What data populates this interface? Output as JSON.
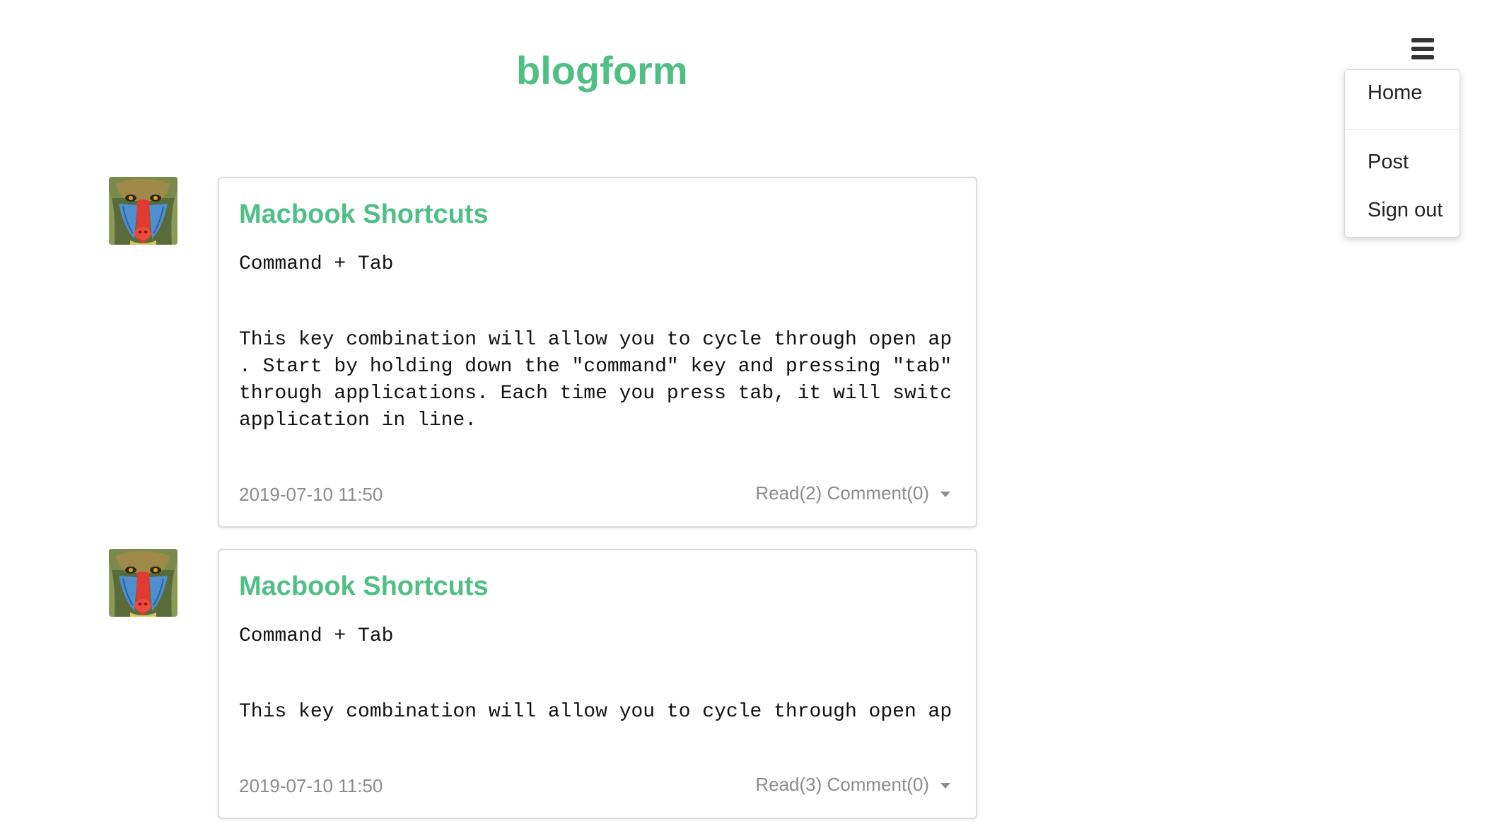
{
  "site": {
    "title": "blogform"
  },
  "menu": {
    "toggle_icon": "hamburger-menu-icon",
    "items": [
      {
        "label": "Home"
      },
      {
        "label": "Post"
      },
      {
        "label": "Sign out"
      }
    ]
  },
  "colors": {
    "accent": "#4fbf86",
    "muted_text": "#8c8c8c",
    "card_border": "#dcdcdc"
  },
  "posts": [
    {
      "avatar_icon": "mandrill-avatar",
      "title": "Macbook Shortcuts",
      "subtitle": "Command + Tab",
      "body": "This key combination will allow you to cycle through open ap\n. Start by holding down the \"command\" key and pressing \"tab\" \nthrough applications. Each time you press tab, it will switc\napplication in line.",
      "date": "2019-07-10 11:50",
      "stats": "Read(2) Comment(0)",
      "stats_icon": "caret-down-icon"
    },
    {
      "avatar_icon": "mandrill-avatar",
      "title": "Macbook Shortcuts",
      "subtitle": "Command + Tab",
      "body": "This key combination will allow you to cycle through open ap",
      "date": "2019-07-10 11:50",
      "stats": "Read(3) Comment(0)",
      "stats_icon": "caret-down-icon"
    }
  ]
}
